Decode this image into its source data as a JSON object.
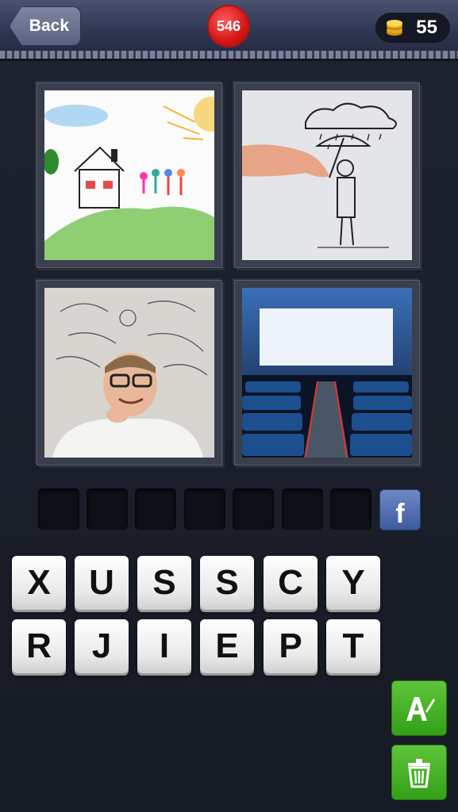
{
  "header": {
    "back_label": "Back",
    "level": "546",
    "coins": "55"
  },
  "pictures": [
    {
      "name": "child-drawing-picture"
    },
    {
      "name": "umbrella-sketch-picture"
    },
    {
      "name": "thinking-man-picture"
    },
    {
      "name": "cinema-screen-picture"
    }
  ],
  "answer_slots": 7,
  "letters": {
    "row1": [
      "X",
      "U",
      "S",
      "S",
      "C",
      "Y"
    ],
    "row2": [
      "R",
      "J",
      "I",
      "E",
      "P",
      "T"
    ]
  },
  "icons": {
    "facebook": "facebook-icon",
    "reveal": "reveal-letter-icon",
    "remove": "trash-icon"
  },
  "colors": {
    "accent_red": "#d41616",
    "green": "#33a018",
    "facebook_blue": "#3c5a9e"
  }
}
